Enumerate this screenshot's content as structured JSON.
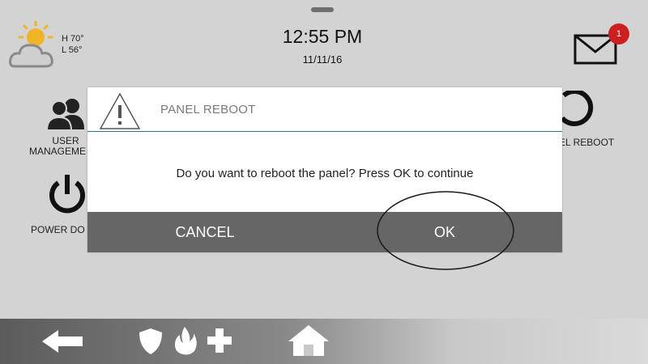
{
  "header": {
    "weather": {
      "icon": "partly-cloudy-icon",
      "high": "H 70°",
      "low": "L 56°"
    },
    "time": "12:55 PM",
    "date": "11/11/16",
    "messages": {
      "icon": "envelope-icon",
      "badge_count": "1"
    }
  },
  "tiles": {
    "user_management": {
      "icon": "users-icon",
      "line1": "USER",
      "line2": "MANAGEME"
    },
    "power_down": {
      "icon": "power-icon",
      "label": "POWER DO"
    },
    "panel_reboot": {
      "icon": "reboot-icon",
      "label": "EL REBOOT"
    }
  },
  "dialog": {
    "icon": "warning-icon",
    "title": "PANEL REBOOT",
    "message": "Do you want to reboot the panel? Press OK to continue",
    "cancel_label": "CANCEL",
    "ok_label": "OK"
  },
  "bottom_nav": {
    "items": [
      "back-arrow-icon",
      "shield-icon",
      "fire-icon",
      "medical-cross-icon",
      "home-icon"
    ]
  },
  "colors": {
    "screen_bg": "#d3d3d3",
    "button_bar": "#666666",
    "badge": "#cc1f1f",
    "divider": "#2f6f8f"
  }
}
